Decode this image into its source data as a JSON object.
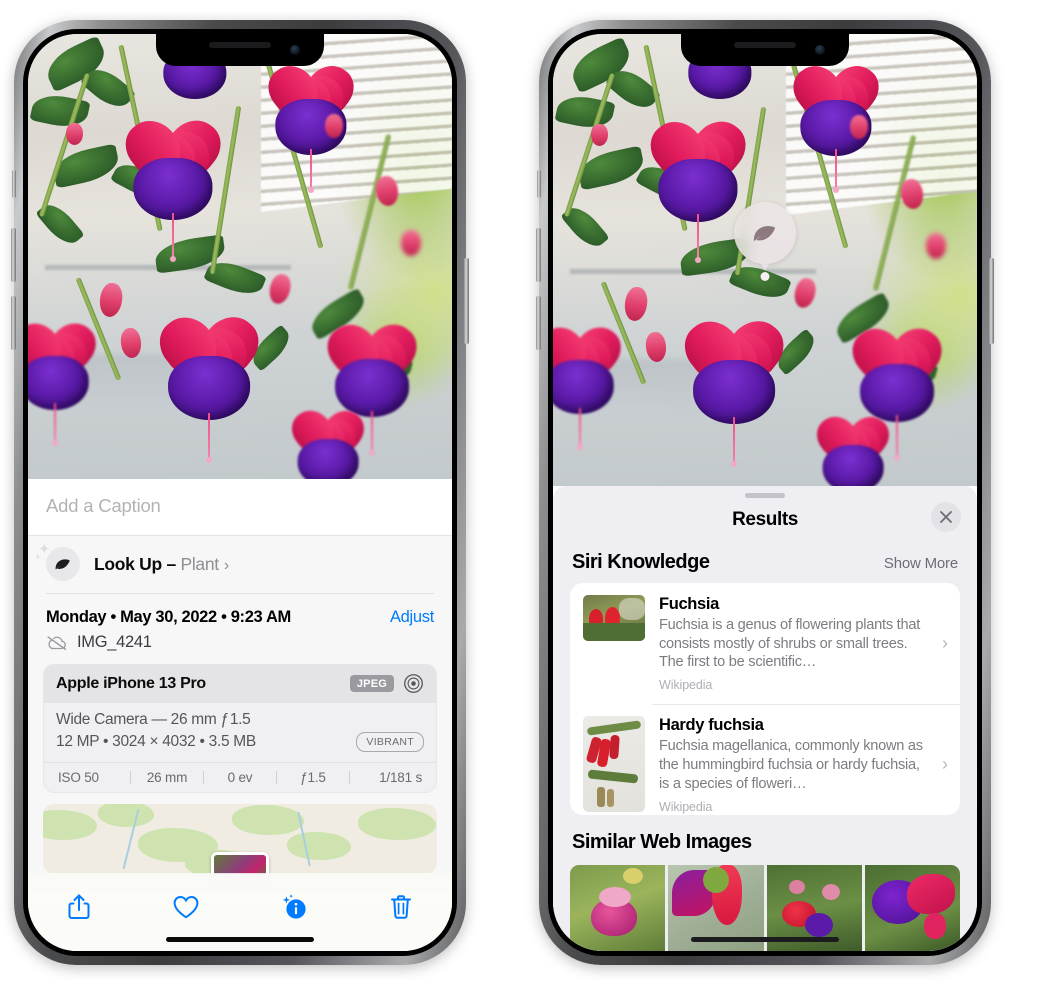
{
  "left_phone": {
    "name": "iPhone photo detail view",
    "caption_placeholder": "Add a Caption",
    "lookup": {
      "icon": "leaf-icon",
      "label_bold": "Look Up",
      "dash": " – ",
      "label_gray": "Plant",
      "chevron": "›"
    },
    "date_line": "Monday • May 30, 2022 • 9:23 AM",
    "adjust_label": "Adjust",
    "file_icon": "cloud-slash-icon",
    "file_name": "IMG_4241",
    "metadata": {
      "device": "Apple iPhone 13 Pro",
      "format_tag": "JPEG",
      "aperture_icon": "aperture-icon",
      "lens_line": "Wide Camera — 26 mm ƒ 1.5",
      "size_line": "12 MP  •  3024 × 4032  •  3.5 MB",
      "style_tag": "VIBRANT",
      "stats": [
        "ISO 50",
        "26 mm",
        "0 ev",
        "ƒ1.5",
        "1/181 s"
      ]
    },
    "toolbar": [
      {
        "name": "share-button",
        "icon": "share-icon"
      },
      {
        "name": "favorite-button",
        "icon": "heart-icon"
      },
      {
        "name": "info-button",
        "icon": "info-sparkle-icon"
      },
      {
        "name": "delete-button",
        "icon": "trash-icon"
      }
    ]
  },
  "right_phone": {
    "name": "Visual Look Up results view",
    "marker_icon": "leaf-icon",
    "sheet_title": "Results",
    "close_icon": "close-icon",
    "siri_section": {
      "title": "Siri Knowledge",
      "show_more": "Show More",
      "items": [
        {
          "title": "Fuchsia",
          "description": "Fuchsia is a genus of flowering plants that consists mostly of shrubs or small trees. The first to be scientific…",
          "source": "Wikipedia",
          "chevron": "›"
        },
        {
          "title": "Hardy fuchsia",
          "description": "Fuchsia magellanica, commonly known as the hummingbird fuchsia or hardy fuchsia, is a species of floweri…",
          "source": "Wikipedia",
          "chevron": "›"
        }
      ]
    },
    "web_section": {
      "title": "Similar Web Images",
      "images": [
        "fuchsia-web-image-1",
        "fuchsia-web-image-2",
        "fuchsia-web-image-3",
        "fuchsia-web-image-4"
      ]
    }
  },
  "colors": {
    "accent_blue": "#007aff",
    "sheet_gray": "#f7f7f8",
    "results_gray": "#efeff3",
    "text_secondary": "#8e8e93",
    "magenta": "#e01b5c",
    "purple": "#5b1aa8"
  }
}
